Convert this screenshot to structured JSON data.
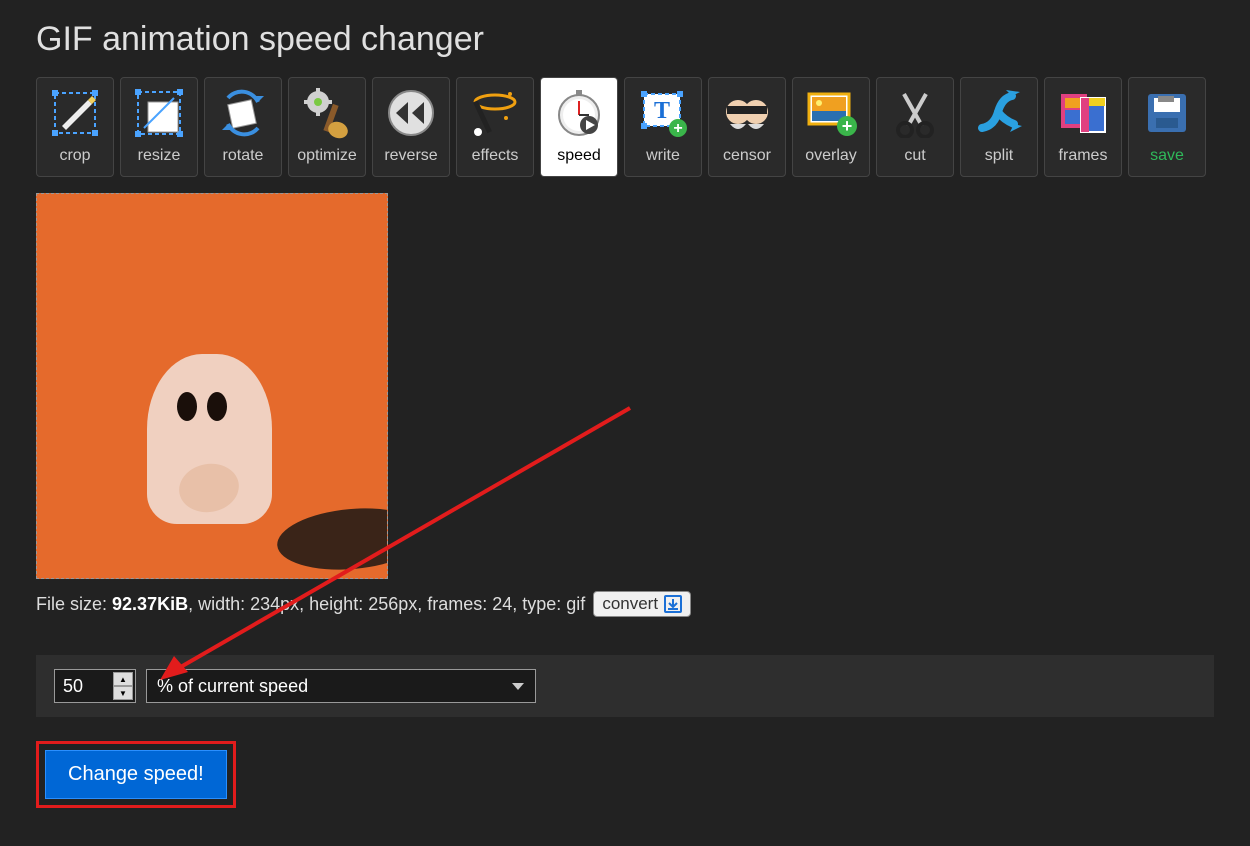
{
  "page": {
    "title": "GIF animation speed changer"
  },
  "toolbar": {
    "items": [
      {
        "name": "crop",
        "label": "crop"
      },
      {
        "name": "resize",
        "label": "resize"
      },
      {
        "name": "rotate",
        "label": "rotate"
      },
      {
        "name": "optimize",
        "label": "optimize"
      },
      {
        "name": "reverse",
        "label": "reverse"
      },
      {
        "name": "effects",
        "label": "effects"
      },
      {
        "name": "speed",
        "label": "speed",
        "active": true
      },
      {
        "name": "write",
        "label": "write"
      },
      {
        "name": "censor",
        "label": "censor"
      },
      {
        "name": "overlay",
        "label": "overlay"
      },
      {
        "name": "cut",
        "label": "cut"
      },
      {
        "name": "split",
        "label": "split"
      },
      {
        "name": "frames",
        "label": "frames"
      },
      {
        "name": "save",
        "label": "save",
        "save": true
      }
    ]
  },
  "file_info": {
    "prefix": "File size: ",
    "size": "92.37KiB",
    "rest": ", width: 234px, height: 256px, frames: 24, type: gif",
    "convert_label": "convert"
  },
  "controls": {
    "speed_value": "50",
    "unit_option": "% of current speed"
  },
  "action": {
    "change_label": "Change speed!"
  }
}
